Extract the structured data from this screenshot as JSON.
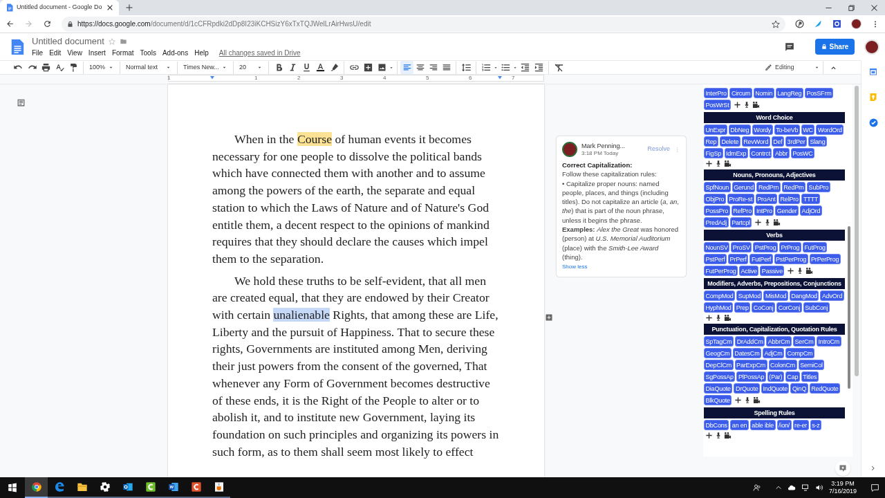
{
  "browser": {
    "tab_title": "Untitled document - Google Do",
    "url_host": "https://docs.google.com",
    "url_path": "/document/d/1cCFRpdki2dDp8I23iKCHSizY6xTxTQJWelLrAirHwsU/edit"
  },
  "docs_header": {
    "title": "Untitled document",
    "menus": [
      "File",
      "Edit",
      "View",
      "Insert",
      "Format",
      "Tools",
      "Add-ons",
      "Help"
    ],
    "save_status": "All changes saved in Drive",
    "share_label": "Share"
  },
  "toolbar": {
    "zoom": "100%",
    "style": "Normal text",
    "font": "Times New...",
    "size": "20",
    "alignments": [
      {
        "kind": "left",
        "selected": true
      },
      {
        "kind": "center",
        "selected": false
      },
      {
        "kind": "right",
        "selected": false
      },
      {
        "kind": "justify",
        "selected": false
      }
    ],
    "mode": "Editing"
  },
  "ruler": {
    "labels": [
      "1",
      "1",
      "2",
      "3",
      "4",
      "5",
      "6",
      "7"
    ]
  },
  "document": {
    "paragraphs": [
      {
        "segments": [
          {
            "text": "When in the ",
            "commented": false,
            "selected": false
          },
          {
            "text": "Course",
            "commented": true,
            "selected": false
          },
          {
            "text": " of human events it becomes necessary for one people to dissolve the political bands which have connected them with another and to assume among the powers of the earth, the separate and equal station to which the Laws of Nature and of Nature's God entitle them, a decent respect to the opinions of mankind requires that they should declare the causes which impel them to the separation.",
            "commented": false,
            "selected": false
          }
        ]
      },
      {
        "segments": [
          {
            "text": "We hold these truths to be self-evident, that all men are created equal, that they are endowed by their Creator with certain ",
            "commented": false,
            "selected": false
          },
          {
            "text": "unalienable",
            "commented": false,
            "selected": true
          },
          {
            "text": " Rights, that among these are Life, Liberty and the pursuit of Happiness. That to secure these rights, Governments are instituted among Men, deriving their just powers from the consent of the governed, That whenever any Form of Government becomes destructive of these ends, it is the Right of the People to alter or to abolish it, and to institute new Government, laying its foundation on such principles and organizing its powers in such form, as to them shall seem most likely to effect",
            "commented": false,
            "selected": false
          }
        ]
      }
    ]
  },
  "comment": {
    "author": "Mark Penning...",
    "time": "3:18 PM Today",
    "resolve": "Resolve",
    "heading": "Correct Capitalization:",
    "lines": [
      "Follow these capitalization rules:",
      "• Capitalize proper nouns: named people, places, and things (including titles). Do not capitalize an article (*a*, *an*, *the*) that is part of the noun phrase, unless it begins the phrase.",
      "**Examples:** *Alex the Great* was honored (person) at *U.S. Memorial Auditorium* (place) with the *Smith-Lee Award* (thing)."
    ],
    "toggle": "Show less"
  },
  "sidebar": {
    "sections": [
      {
        "buttons": [
          "InterPro",
          "Circum",
          "Nomin",
          "LangReg",
          "PosSFrm",
          "PosWrSt"
        ]
      },
      {
        "title": "Word Choice",
        "buttons": [
          "UnExpr",
          "DbNeg",
          "Wordy",
          "To-beVb",
          "WC",
          "WordOrd",
          "Rep",
          "Delete",
          "RevWord",
          "Def",
          "3rdPer",
          "Slang",
          "FigSp",
          "IdmExp",
          "Contrct",
          "Abbr",
          "PosWC"
        ]
      },
      {
        "title": "Nouns, Pronouns, Adjectives",
        "buttons": [
          "SpfNoun",
          "Gerund",
          "RedPrn",
          "RedPrn",
          "SubPro",
          "ObjPro",
          "ProRe-st",
          "ProAnt",
          "RelPro",
          "TTTT",
          "PossPro",
          "RefPro",
          "IntPro",
          "Gender",
          "AdjOrd",
          "PredAdj",
          "Partcpl"
        ]
      },
      {
        "title": "Verbs",
        "buttons": [
          "NounSV",
          "ProSV",
          "PstProg",
          "PrProg",
          "FutProg",
          "PstPerf",
          "PrPerf",
          "FutPerf",
          "PstPerProg",
          "PrPerProg",
          "FutPerProg",
          "Active",
          "Passive"
        ]
      },
      {
        "title": "Modifiers, Adverbs, Prepositions, Conjunctions",
        "buttons": [
          "CompMod",
          "SupMod",
          "MisMod",
          "DangMod",
          "AdvOrd",
          "HyphMod",
          "Prep",
          "CoConj",
          "CorConj",
          "SubConj"
        ]
      },
      {
        "title": "Punctuation, Capitalization, Quotation Rules",
        "buttons": [
          "SpTagCm",
          "DrAddCm",
          "AbbrCm",
          "SerCm",
          "IntroCm",
          "GeogCm",
          "DatesCm",
          "AdjCm",
          "CompCm",
          "DepClCm",
          "ParExpCm",
          "ColonCm",
          "SemiCol",
          "SgPossAp",
          "PlPossAp",
          "(Par)",
          "Cap",
          "Titles",
          "DiaQuote",
          "DrQuote",
          "IndQuote",
          "QinQ",
          "RedQuote",
          "BlkQuote"
        ]
      },
      {
        "title": "Spelling Rules",
        "buttons": [
          "DbCons",
          "an en",
          "able ible",
          "/ion/",
          "re-er",
          "s-z"
        ]
      }
    ]
  },
  "taskbar": {
    "apps": [
      {
        "kind": "chrome",
        "active": true
      },
      {
        "kind": "edge",
        "active": false
      },
      {
        "kind": "folder",
        "active": false
      },
      {
        "kind": "settings",
        "active": false
      },
      {
        "kind": "outlook",
        "active": false
      },
      {
        "kind": "green_app",
        "active": false
      },
      {
        "kind": "word",
        "active": false
      },
      {
        "kind": "red_app",
        "active": false
      },
      {
        "kind": "cup_app",
        "active": false
      }
    ],
    "time": "3:19 PM",
    "date": "7/16/2019"
  }
}
